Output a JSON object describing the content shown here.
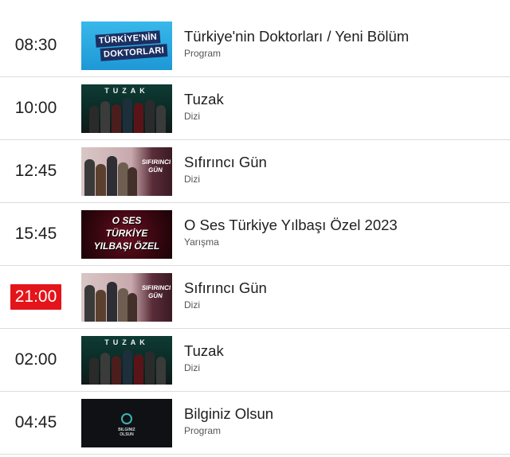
{
  "schedule": [
    {
      "time": "08:30",
      "title": "Türkiye'nin Doktorları / Yeni Bölüm",
      "category": "Program",
      "live": false,
      "thumb": {
        "line1": "TÜRKİYE'NİN",
        "line2": "DOKTORLARI"
      }
    },
    {
      "time": "10:00",
      "title": "Tuzak",
      "category": "Dizi",
      "live": false,
      "thumb": {
        "logo": "TUZAK"
      }
    },
    {
      "time": "12:45",
      "title": "Sıfırıncı Gün",
      "category": "Dizi",
      "live": false,
      "thumb": {
        "logo": "SIFIRINCI GÜN"
      }
    },
    {
      "time": "15:45",
      "title": "O Ses Türkiye Yılbaşı Özel 2023",
      "category": "Yarışma",
      "live": false,
      "thumb": {
        "line1": "O SES",
        "line2": "TÜRKİYE",
        "line3": "YILBAŞI ÖZEL"
      }
    },
    {
      "time": "21:00",
      "title": "Sıfırıncı Gün",
      "category": "Dizi",
      "live": true,
      "thumb": {
        "logo": "SIFIRINCI GÜN"
      }
    },
    {
      "time": "02:00",
      "title": "Tuzak",
      "category": "Dizi",
      "live": false,
      "thumb": {
        "logo": "TUZAK"
      }
    },
    {
      "time": "04:45",
      "title": "Bilginiz Olsun",
      "category": "Program",
      "live": false,
      "thumb": {
        "line1": "BILGINIZ",
        "line2": "OLSUN"
      }
    }
  ],
  "colors": {
    "live_badge": "#e4141b",
    "divider": "#dcdcdc"
  }
}
